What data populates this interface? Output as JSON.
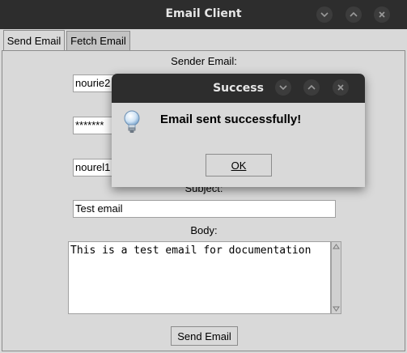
{
  "window": {
    "title": "Email Client",
    "controls": [
      "minimize-icon",
      "maximize-icon",
      "close-icon"
    ]
  },
  "tabs": [
    {
      "label": "Send Email",
      "active": true
    },
    {
      "label": "Fetch Email",
      "active": false
    }
  ],
  "form": {
    "sender_label": "Sender Email:",
    "sender_value": "nourie2",
    "password_value": "*******",
    "recipient_value": "nourel1",
    "subject_label": "Subject:",
    "subject_value": "Test email",
    "body_label": "Body:",
    "body_value": "This is a test email for documentation",
    "send_button": "Send Email"
  },
  "dialog": {
    "title": "Success",
    "message": "Email sent successfully!",
    "icon": "lightbulb-info-icon",
    "ok_label": "OK"
  },
  "colors": {
    "titlebar": "#2d2d2d",
    "window_bg": "#d9d9d9",
    "title_text": "#e6e6e6"
  }
}
